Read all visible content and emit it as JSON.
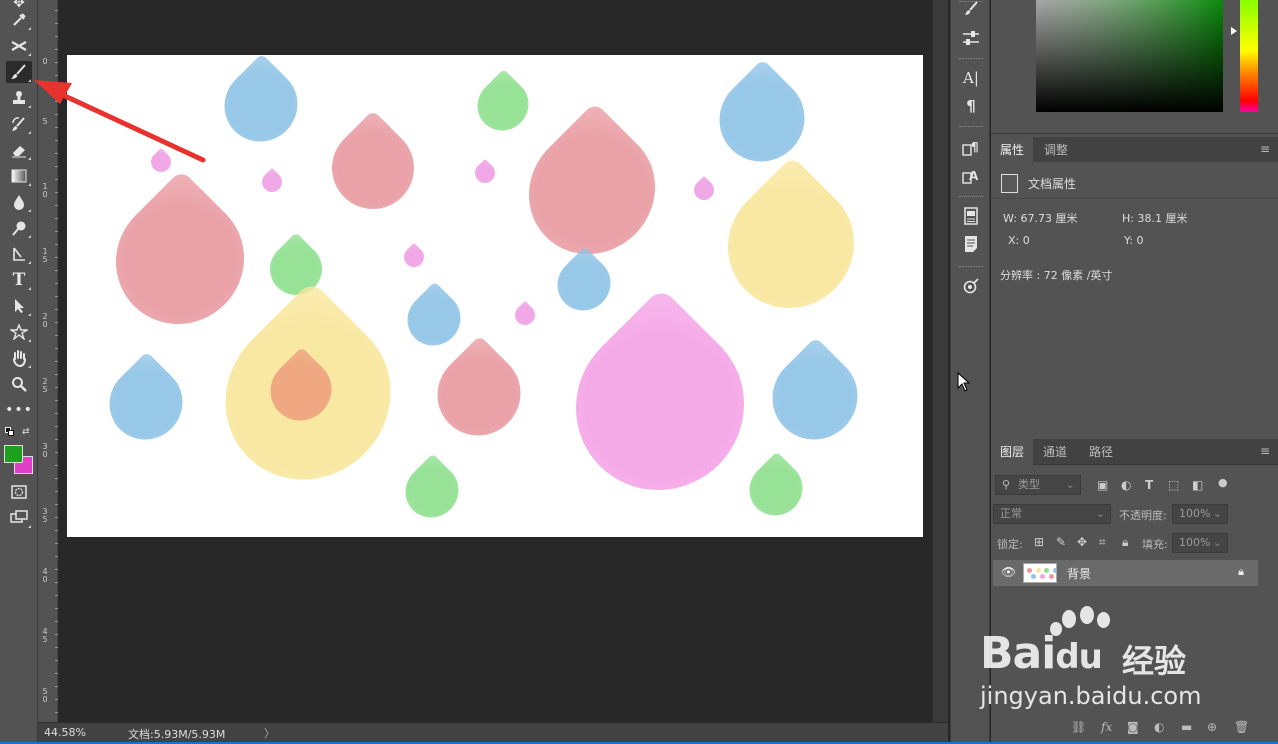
{
  "status": {
    "zoom": "44.58%",
    "doc_info": "文档:5.93M/5.93M",
    "arrow": "〉"
  },
  "ruler": {
    "marks": [
      "0",
      "5",
      "1\n0",
      "1\n5",
      "2\n0",
      "2\n5",
      "3\n0",
      "3\n5",
      "4\n0",
      "4\n5",
      "5\n0"
    ]
  },
  "panels": {
    "properties_tab": "属性",
    "adjust_tab": "调整",
    "doc_props_title": "文档属性",
    "w_label": "W:",
    "w_value": "67.73 厘米",
    "h_label": "H:",
    "h_value": "38.1 厘米",
    "x_label": "X:",
    "x_value": "0",
    "y_label": "Y:",
    "y_value": "0",
    "resolution": "分辨率 : 72 像素 /英寸"
  },
  "layers": {
    "tab_layers": "图层",
    "tab_channels": "通道",
    "tab_paths": "路径",
    "filter_placeholder": "类型",
    "blend_mode": "正常",
    "opacity_label": "不透明度:",
    "opacity_value": "100%",
    "lock_label": "锁定:",
    "fill_label": "填充:",
    "fill_value": "100%",
    "layer_name": "背景"
  },
  "watermark": {
    "brand": "Bai",
    "brand2": "du",
    "jingyan": "经验",
    "url": "jingyan.baidu.com"
  },
  "colors": {
    "foreground": "#1ea01e",
    "background": "#e040c8",
    "accent_arrow": "#e8322e"
  },
  "tools": [
    "eyedropper-icon",
    "healing-icon",
    "brush-icon",
    "stamp-icon",
    "history-brush-icon",
    "eraser-icon",
    "gradient-icon",
    "blur-icon",
    "dodge-icon",
    "pen-icon",
    "type-icon",
    "selection-icon",
    "shape-icon",
    "hand-icon",
    "zoom-icon",
    "more-icon"
  ]
}
